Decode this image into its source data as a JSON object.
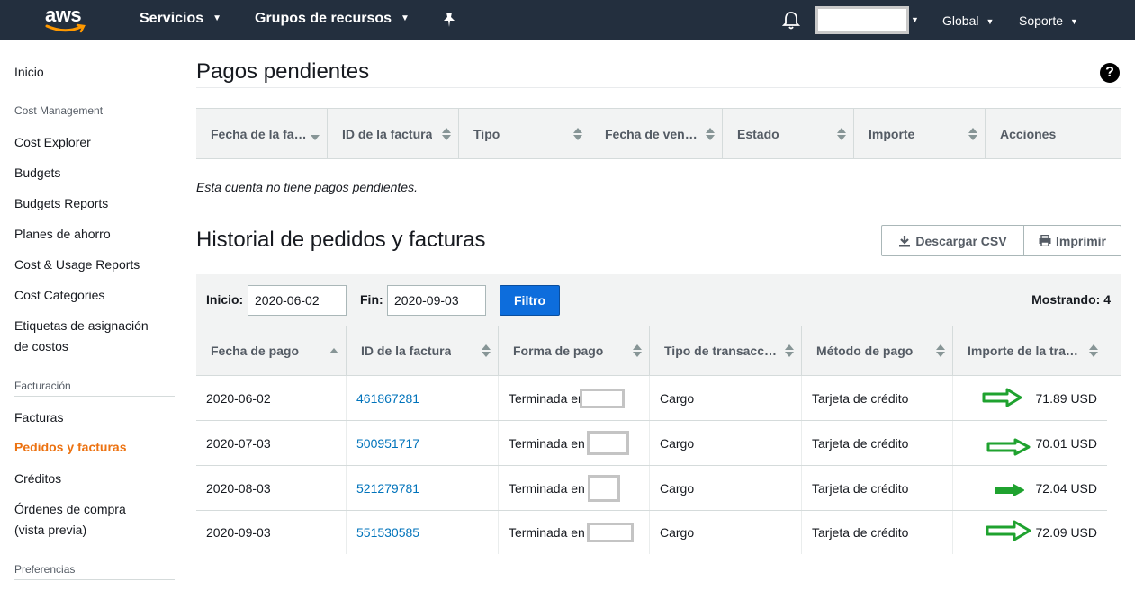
{
  "topnav": {
    "logo_text": "aws",
    "services": "Servicios",
    "resource_groups": "Grupos de recursos",
    "region": "Global",
    "support": "Soporte"
  },
  "sidebar": {
    "home": "Inicio",
    "cost_management": {
      "title": "Cost Management",
      "items": [
        "Cost Explorer",
        "Budgets",
        "Budgets Reports",
        "Planes de ahorro",
        "Cost & Usage Reports",
        "Cost Categories",
        "Etiquetas de asignación",
        "de costos"
      ]
    },
    "billing": {
      "title": "Facturación",
      "items": [
        "Facturas",
        "Pedidos y facturas",
        "Créditos",
        "Órdenes de compra",
        "(vista previa)"
      ]
    },
    "preferences": {
      "title": "Preferencias"
    }
  },
  "pending": {
    "title": "Pagos pendientes",
    "columns": [
      "Fecha de la fa…",
      "ID de la factura",
      "Tipo",
      "Fecha de ven…",
      "Estado",
      "Importe",
      "Acciones"
    ],
    "empty_message": "Esta cuenta no tiene pagos pendientes."
  },
  "history": {
    "title": "Historial de pedidos y facturas",
    "download_csv": "Descargar CSV",
    "print": "Imprimir",
    "filter": {
      "start_label": "Inicio:",
      "start_value": "2020-06-02",
      "end_label": "Fin:",
      "end_value": "2020-09-03",
      "button": "Filtro",
      "showing": "Mostrando: 4"
    },
    "columns": [
      "Fecha de pago",
      "ID de la factura",
      "Forma de pago",
      "Tipo de transacc…",
      "Método de pago",
      "Importe de la tra…"
    ],
    "rows": [
      {
        "date": "2020-06-02",
        "invoice": "461867281",
        "payment_form": "Terminada en",
        "type": "Cargo",
        "method": "Tarjeta de crédito",
        "amount": "71.89 USD"
      },
      {
        "date": "2020-07-03",
        "invoice": "500951717",
        "payment_form": "Terminada en",
        "type": "Cargo",
        "method": "Tarjeta de crédito",
        "amount": "70.01 USD"
      },
      {
        "date": "2020-08-03",
        "invoice": "521279781",
        "payment_form": "Terminada en",
        "type": "Cargo",
        "method": "Tarjeta de crédito",
        "amount": "72.04 USD"
      },
      {
        "date": "2020-09-03",
        "invoice": "551530585",
        "payment_form": "Terminada en",
        "type": "Cargo",
        "method": "Tarjeta de crédito",
        "amount": "72.09 USD"
      }
    ]
  },
  "colors": {
    "nav_bg": "#232f3e",
    "active_link": "#ec7211",
    "link": "#0073bb",
    "primary_button": "#0d6ddc",
    "annotation_arrow": "#1fa22f"
  }
}
